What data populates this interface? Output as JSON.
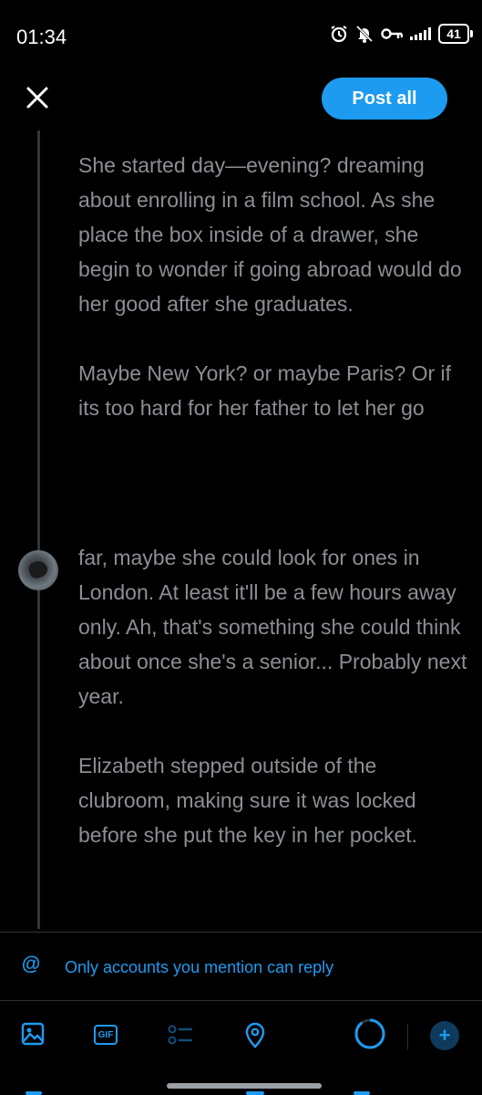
{
  "status_bar": {
    "time": "01:34",
    "battery": "41",
    "icons": [
      "alarm-icon",
      "bell-muted-icon",
      "vpn-key-icon",
      "signal-icon",
      "battery-icon"
    ]
  },
  "header": {
    "close_icon": "close-icon",
    "post_label": "Post all"
  },
  "thread": {
    "post1_text": "She started day—evening? dreaming about enrolling in a film school. As she place the box inside of a drawer, she begin to wonder if going abroad would do her good after she graduates.\n\nMaybe New York? or maybe Paris? Or if its too hard for her father to let her go",
    "post2_text": "far, maybe she could look for ones in London. At least it'll be a few hours away only. Ah, that's something she could think about once she's a senior... Probably next year.\n\nElizabeth stepped outside of the clubroom, making sure it was locked before she put the key in her pocket."
  },
  "reply_setting": {
    "icon": "at-icon",
    "label": "Only accounts you mention can reply"
  },
  "toolbar": {
    "items": [
      "image-icon",
      "gif-icon",
      "poll-icon",
      "location-icon",
      "character-count-ring",
      "add-post-icon"
    ],
    "gif_label": "GIF",
    "add_label": "+"
  },
  "colors": {
    "accent": "#1d9bf0",
    "background": "#000000",
    "text_muted": "#8b8f94"
  }
}
